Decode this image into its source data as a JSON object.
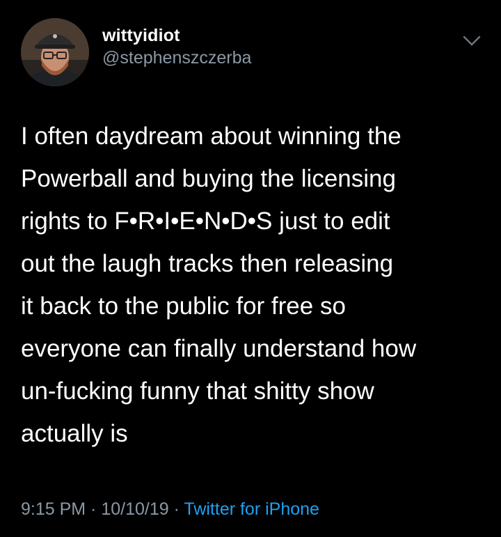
{
  "tweet": {
    "author": {
      "display_name": "wittyidiot",
      "handle": "@stephenszczerba",
      "avatar_icon": "user-avatar-photo"
    },
    "menu_icon": "chevron-down-icon",
    "text": "I often daydream about winning the\nPowerball and buying the licensing\nrights to F•R•I•E•N•D•S just to edit\nout the laugh tracks then releasing\nit back to the public for free so\neveryone can finally understand how\nun-fucking funny that shitty show\nactually is",
    "time": "9:15 PM",
    "separator": " · ",
    "date": "10/10/19",
    "source": "Twitter for iPhone"
  },
  "colors": {
    "background": "#000000",
    "primary_text": "#ffffff",
    "secondary_text": "#8b98a5",
    "link": "#1da1f2"
  }
}
